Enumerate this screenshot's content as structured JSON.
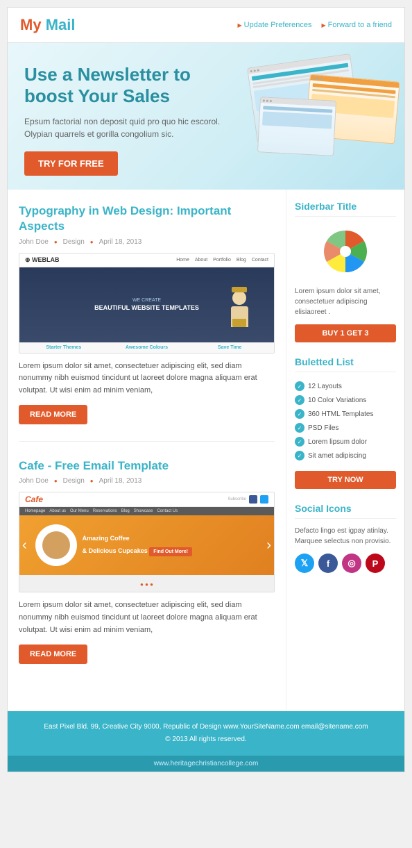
{
  "header": {
    "logo_my": "My",
    "logo_mail": "Mail",
    "link_update": "Update Preferences",
    "link_forward": "Forward to a friend"
  },
  "hero": {
    "headline": "Use a Newsletter to boost Your Sales",
    "body": "Epsum factorial non deposit quid pro quo hic escorol. Olypian quarrels et gorilla congolium sic.",
    "cta": "TRY FOR FREE"
  },
  "article1": {
    "title": "Typography in Web Design: Important Aspects",
    "author": "John Doe",
    "category": "Design",
    "date": "April 18, 2013",
    "body": "Lorem ipsum dolor sit amet, consectetuer adipiscing elit, sed diam nonummy nibh euismod tincidunt ut laoreet dolore magna aliquam erat volutpat. Ut wisi enim ad minim veniam,",
    "cta": "READ MORE",
    "weblab": {
      "logo": "WEBLAB",
      "tagline": "WE CREATE BEAUTIFUL WEBSITE TEMPLATES",
      "nav": [
        "Home",
        "About",
        "Portfolio",
        "Blog",
        "Contact"
      ],
      "footer_items": [
        "Starter Themes",
        "Awesome Colours",
        "Save Time"
      ]
    }
  },
  "article2": {
    "title": "Cafe - Free Email Template",
    "author": "John Doe",
    "category": "Design",
    "date": "April 18, 2013",
    "body": "Lorem ipsum dolor sit amet, consectetuer adipiscing elit, sed diam nonummy nibh euismod tincidunt ut laoreet dolore magna aliquam erat volutpat. Ut wisi enim ad minim veniam,",
    "cta": "READ MORE",
    "cafe": {
      "logo": "Cafe",
      "promo": "Amazing Coffee & Delicious Cupcakes",
      "nav": [
        "Homepage",
        "About us",
        "Our Menu",
        "Reservations",
        "Blog",
        "Showcase",
        "Contact Us"
      ]
    }
  },
  "sidebar": {
    "section1": {
      "title": "Siderbar Title",
      "body": "Lorem ipsum dolor sit amet, consectetuer adipiscing elisiaoreet .",
      "cta": "BUY 1 GET 3"
    },
    "section2": {
      "title": "Buletted List",
      "items": [
        "12 Layouts",
        "10 Color Variations",
        "360 HTML Templates",
        "PSD Files",
        "Lorem lipsum dolor",
        "Sit amet adipiscing"
      ],
      "cta": "TRY NOW"
    },
    "section3": {
      "title": "Social Icons",
      "body": "Defacto lingo est igpay atinlay. Marquee selectus non provisio.",
      "icons": [
        "twitter",
        "facebook",
        "instagram",
        "pinterest"
      ]
    }
  },
  "footer": {
    "address": "East Pixel Bld. 99, Creative City 9000, Republic of Design www.YourSiteName.com email@sitename.com",
    "copyright": "© 2013 All rights reserved.",
    "bottom": "www.heritagechristiancollege.com"
  }
}
